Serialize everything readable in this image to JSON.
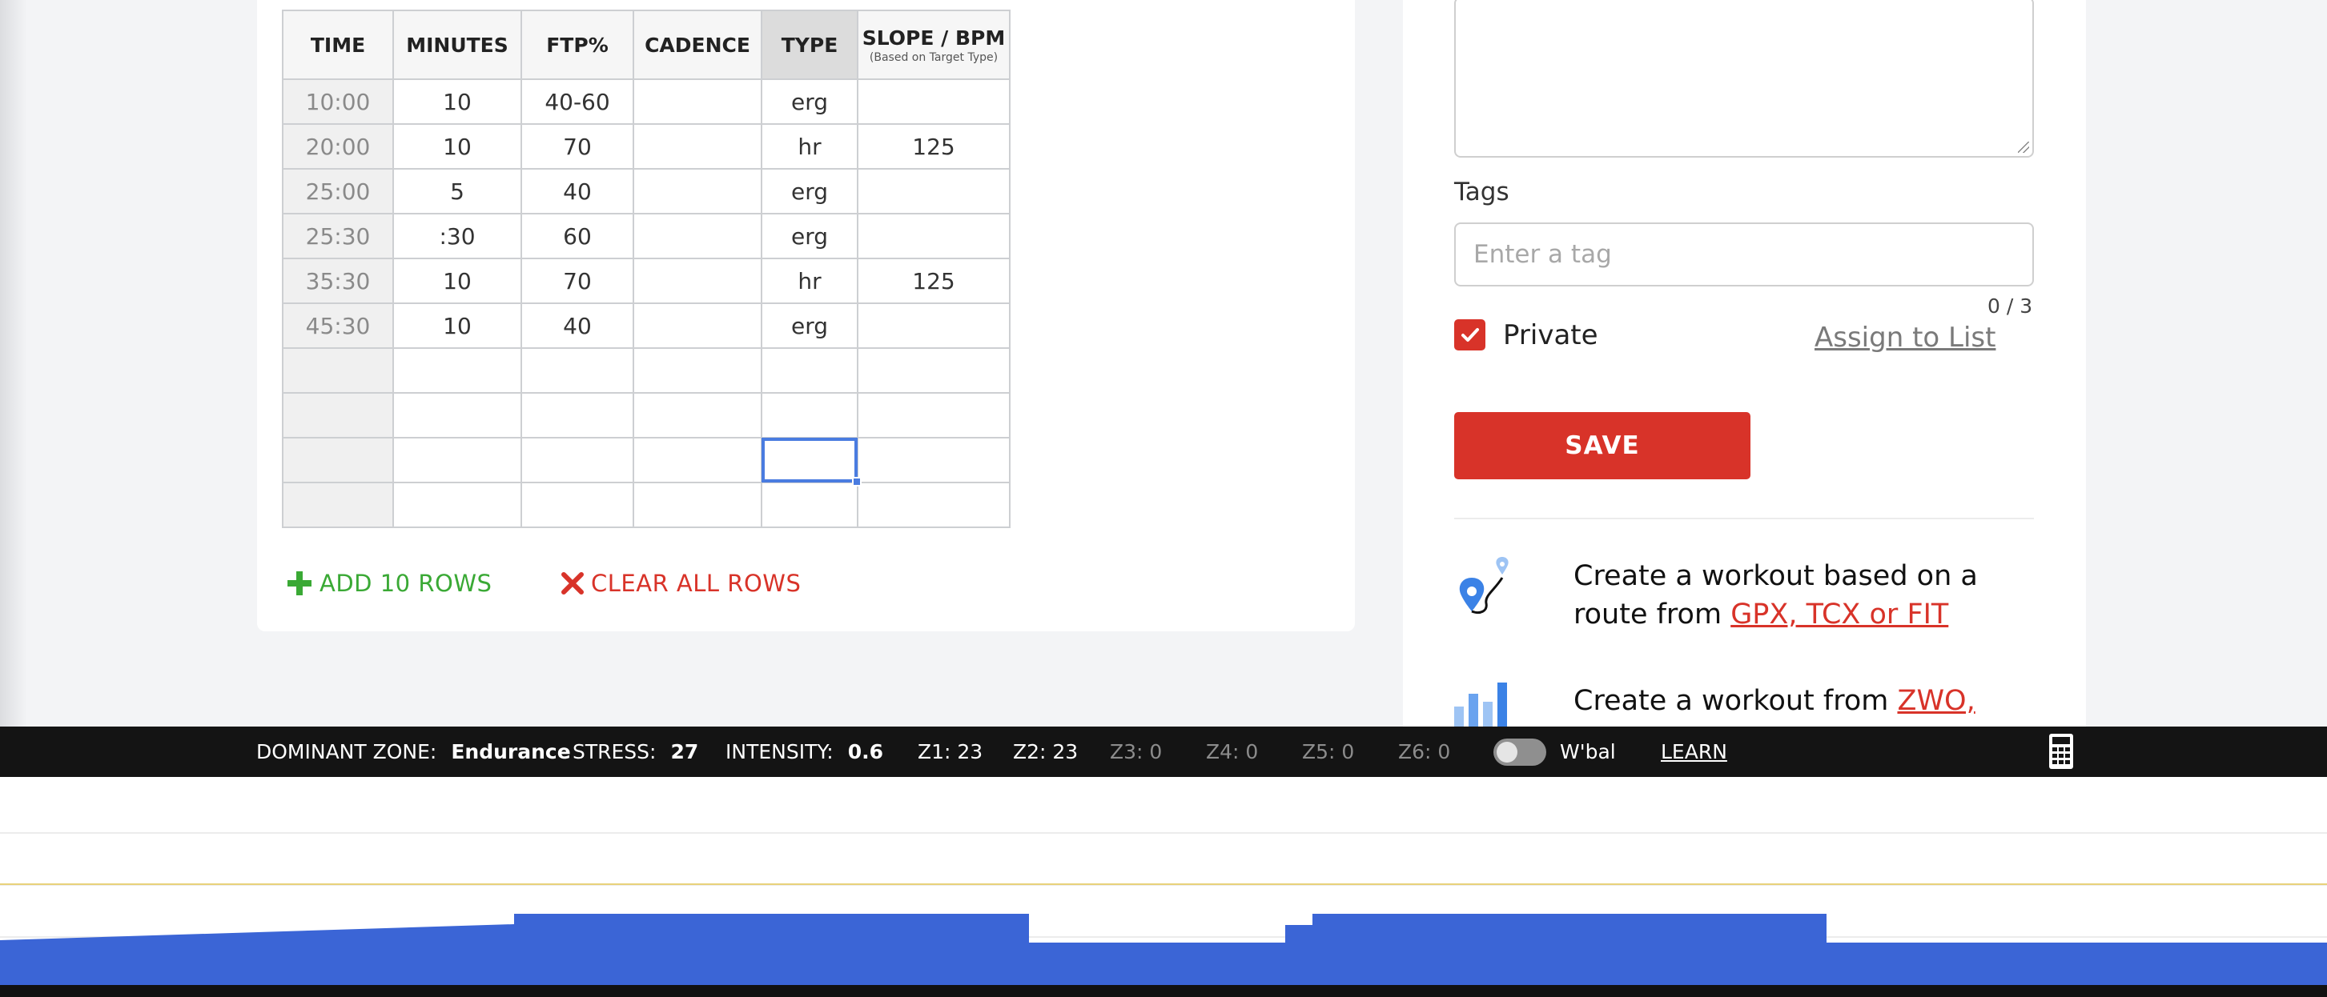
{
  "table": {
    "headers": {
      "time": "TIME",
      "minutes": "MINUTES",
      "ftp": "FTP%",
      "cadence": "CADENCE",
      "type": "TYPE",
      "slope_bpm": "SLOPE / BPM",
      "slope_note": "(Based on Target Type)"
    },
    "rows": [
      {
        "time": "10:00",
        "minutes": "10",
        "ftp": "40-60",
        "cadence": "",
        "type": "erg",
        "slope": ""
      },
      {
        "time": "20:00",
        "minutes": "10",
        "ftp": "70",
        "cadence": "",
        "type": "hr",
        "slope": "125"
      },
      {
        "time": "25:00",
        "minutes": "5",
        "ftp": "40",
        "cadence": "",
        "type": "erg",
        "slope": ""
      },
      {
        "time": "25:30",
        "minutes": ":30",
        "ftp": "60",
        "cadence": "",
        "type": "erg",
        "slope": ""
      },
      {
        "time": "35:30",
        "minutes": "10",
        "ftp": "70",
        "cadence": "",
        "type": "hr",
        "slope": "125"
      },
      {
        "time": "45:30",
        "minutes": "10",
        "ftp": "40",
        "cadence": "",
        "type": "erg",
        "slope": ""
      },
      {
        "time": "",
        "minutes": "",
        "ftp": "",
        "cadence": "",
        "type": "",
        "slope": ""
      },
      {
        "time": "",
        "minutes": "",
        "ftp": "",
        "cadence": "",
        "type": "",
        "slope": ""
      },
      {
        "time": "",
        "minutes": "",
        "ftp": "",
        "cadence": "",
        "type": "",
        "slope": ""
      },
      {
        "time": "",
        "minutes": "",
        "ftp": "",
        "cadence": "",
        "type": "",
        "slope": ""
      }
    ],
    "add_rows_label": "ADD 10 ROWS",
    "clear_rows_label": "CLEAR ALL ROWS"
  },
  "form": {
    "tags_label": "Tags",
    "tag_placeholder": "Enter a tag",
    "tag_counter": "0 / 3",
    "private_label": "Private",
    "private_checked": true,
    "assign_link": "Assign to List",
    "save_label": "SAVE"
  },
  "promos": [
    {
      "text": "Create a workout based on a route from ",
      "link": "GPX, TCX or FIT",
      "icon": "route-pin-icon"
    },
    {
      "text": "Create a workout from ",
      "link": "ZWO,",
      "icon": "bar-chart-icon"
    }
  ],
  "status_bar": {
    "dominant_zone_label": "DOMINANT ZONE:",
    "dominant_zone_value": "Endurance",
    "stress_label": "STRESS:",
    "stress_value": "27",
    "intensity_label": "INTENSITY:",
    "intensity_value": "0.6",
    "zones": [
      "Z1: 23",
      "Z2: 23",
      "Z3: 0",
      "Z4: 0",
      "Z5: 0",
      "Z6: 0"
    ],
    "wbal_label": "W'bal",
    "wbal_enabled": false,
    "learn_label": "LEARN"
  },
  "colors": {
    "brand_red": "#d83329",
    "add_green": "#3aa935",
    "graph_blue": "#3b65d6",
    "threshold_yellow": "#e8d27a",
    "selection_blue": "#4a7ce0"
  }
}
